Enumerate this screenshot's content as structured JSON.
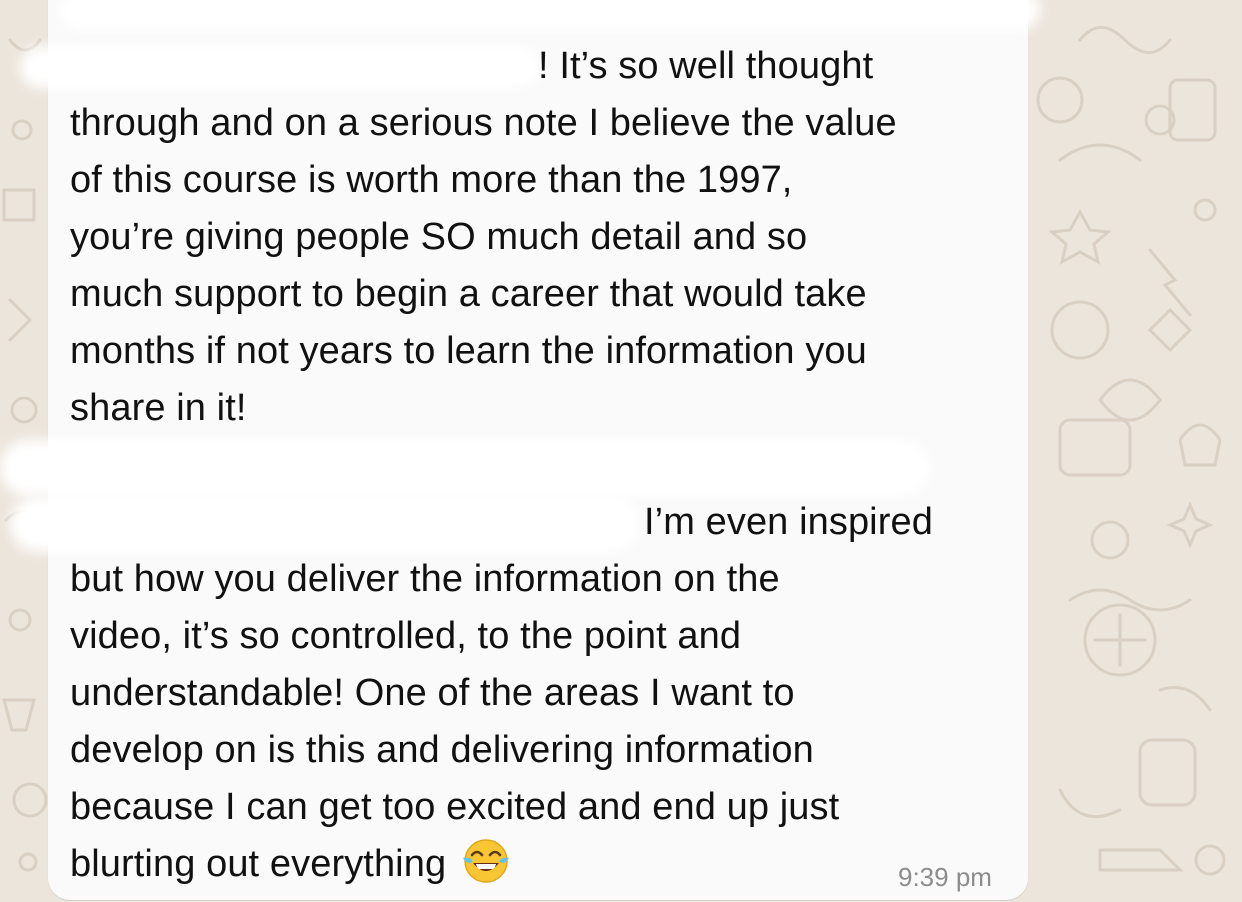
{
  "message": {
    "lines": [
      "! It’s so well thought",
      "through and on a serious note I believe the value",
      "of this course is worth more than the 1997,",
      "you’re giving people SO much detail and so",
      "much support to begin a career that would take",
      "months if not years to learn the information you",
      "share in it!",
      "I’m even inspired",
      "but how you deliver the information on the",
      "video, it’s so controlled, to the point and",
      "understandable! One of the areas I want to",
      "develop on is this and delivering information",
      "because I can get too excited and end up just",
      "blurting out everything"
    ],
    "emoji": "tears-of-joy-emoji",
    "timestamp": "9:39 pm"
  },
  "colors": {
    "bubble": "#fafafa",
    "wallpaper": "#ece5dc",
    "text": "#111111",
    "timestamp": "#8c8c8c"
  }
}
